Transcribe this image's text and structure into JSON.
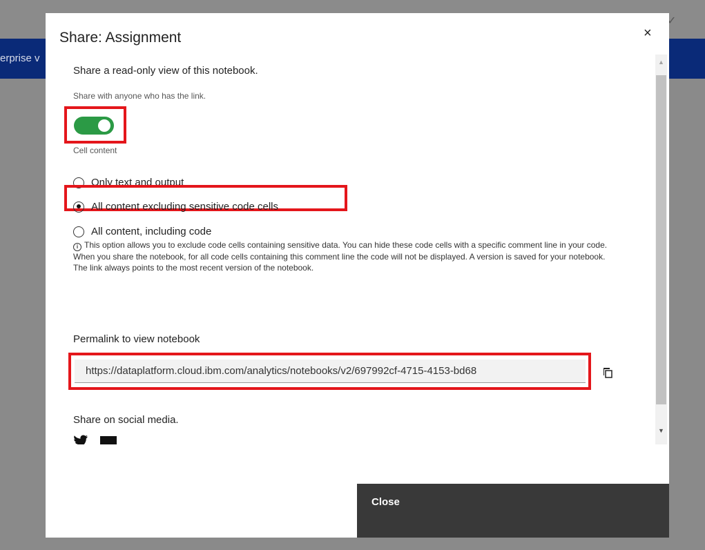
{
  "background": {
    "nav_fragment": "erprise v",
    "check_glyph": "✓"
  },
  "modal": {
    "title": "Share: Assignment",
    "close_glyph": "×",
    "subtitle": "Share a read-only view of this notebook.",
    "share_desc": "Share with anyone who has the link.",
    "toggle_on": true,
    "cell_content_label": "Cell content",
    "options": [
      {
        "label": "Only text and output",
        "checked": false
      },
      {
        "label": "All content excluding sensitive code cells",
        "checked": true
      },
      {
        "label": "All content, including code",
        "checked": false
      }
    ],
    "info_icon": "i",
    "info_text": "This option allows you to exclude code cells containing sensitive data. You can hide these code cells with a specific comment line in your code. When you share the notebook, for all code cells containing this comment line the code will not be displayed. A version is saved for your notebook. The link always points to the most recent version of the notebook.",
    "permalink_label": "Permalink to view notebook",
    "permalink_value": "https://dataplatform.cloud.ibm.com/analytics/notebooks/v2/697992cf-4715-4153-bd68",
    "social_label": "Share on social media.",
    "social_icons": [
      "twitter-icon",
      "linkedin-icon"
    ],
    "close_button": "Close"
  },
  "colors": {
    "toggle_on": "#2b9a45",
    "highlight": "#e4161b",
    "header_bar": "#0a2a78",
    "close_button_bg": "#393939"
  }
}
